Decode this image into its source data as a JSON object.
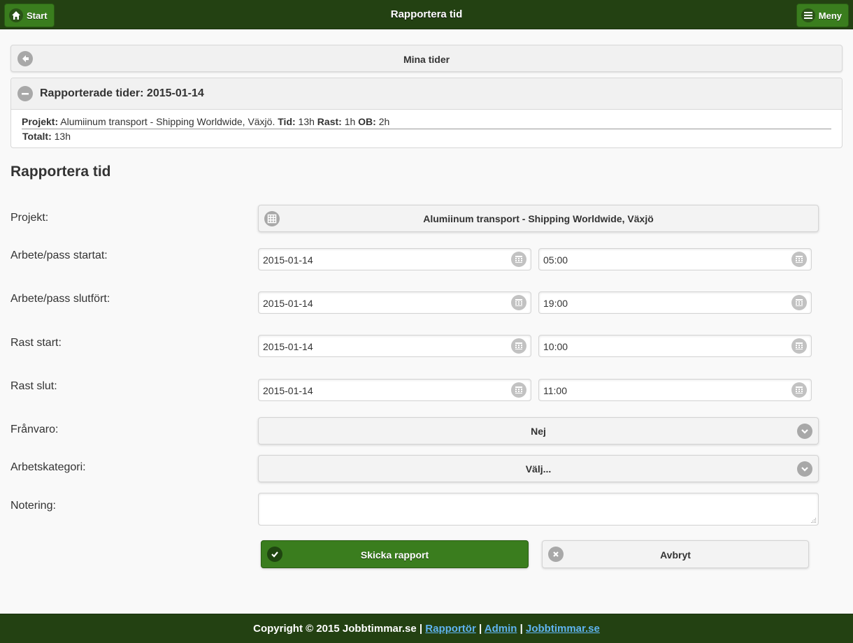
{
  "header": {
    "title": "Rapportera tid",
    "start_label": "Start",
    "menu_label": "Meny"
  },
  "mina": {
    "label": "Mina tider"
  },
  "reported": {
    "title": "Rapporterade tider: 2015-01-14",
    "project_label": "Projekt:",
    "project_value": "Alumiinum transport - Shipping Worldwide, Växjö.",
    "tid_label": "Tid:",
    "tid_value": "13h",
    "rast_label": "Rast:",
    "rast_value": "1h",
    "ob_label": "OB:",
    "ob_value": "2h",
    "total_label": "Totalt:",
    "total_value": "13h"
  },
  "form": {
    "heading": "Rapportera tid",
    "project_label": "Projekt:",
    "project_value": "Alumiinum transport - Shipping Worldwide, Växjö",
    "rows": [
      {
        "label": "Arbete/pass startat:",
        "date": "2015-01-14",
        "time": "05:00"
      },
      {
        "label": "Arbete/pass slutfört:",
        "date": "2015-01-14",
        "time": "19:00"
      },
      {
        "label": "Rast start:",
        "date": "2015-01-14",
        "time": "10:00"
      },
      {
        "label": "Rast slut:",
        "date": "2015-01-14",
        "time": "11:00"
      }
    ],
    "absence_label": "Frånvaro:",
    "absence_value": "Nej",
    "category_label": "Arbetskategori:",
    "category_value": "Välj...",
    "note_label": "Notering:",
    "submit_label": "Skicka rapport",
    "cancel_label": "Avbryt"
  },
  "footer": {
    "copyright": "Copyright © 2015 Jobbtimmar.se",
    "sep": "|",
    "link1": "Rapportör",
    "link2": "Admin",
    "link3": "Jobbtimmar.se"
  },
  "colors": {
    "header_bg": "#234112",
    "button_green": "#3a7d1e",
    "footer_link": "#5fb4f0"
  }
}
